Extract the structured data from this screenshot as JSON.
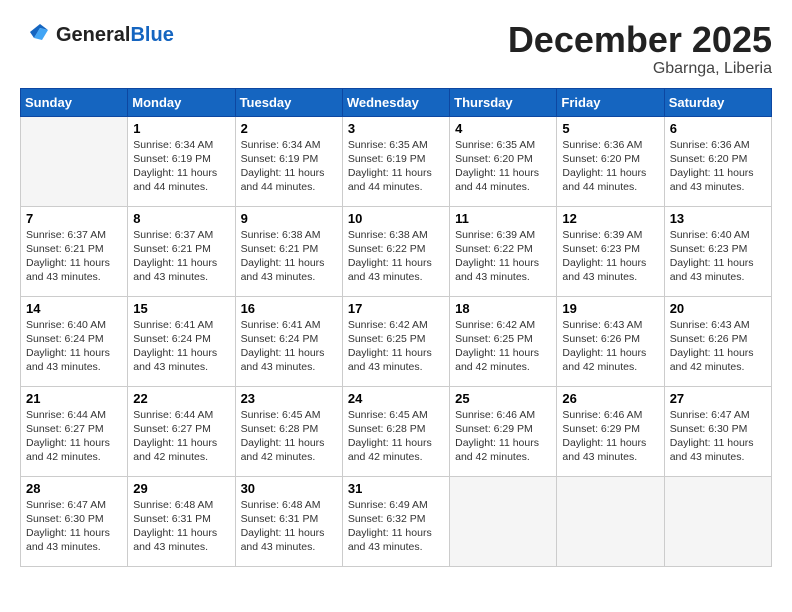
{
  "header": {
    "logo_line1": "General",
    "logo_line2": "Blue",
    "month": "December 2025",
    "location": "Gbarnga, Liberia"
  },
  "weekdays": [
    "Sunday",
    "Monday",
    "Tuesday",
    "Wednesday",
    "Thursday",
    "Friday",
    "Saturday"
  ],
  "weeks": [
    [
      {
        "day": "",
        "info": ""
      },
      {
        "day": "1",
        "info": "Sunrise: 6:34 AM\nSunset: 6:19 PM\nDaylight: 11 hours\nand 44 minutes."
      },
      {
        "day": "2",
        "info": "Sunrise: 6:34 AM\nSunset: 6:19 PM\nDaylight: 11 hours\nand 44 minutes."
      },
      {
        "day": "3",
        "info": "Sunrise: 6:35 AM\nSunset: 6:19 PM\nDaylight: 11 hours\nand 44 minutes."
      },
      {
        "day": "4",
        "info": "Sunrise: 6:35 AM\nSunset: 6:20 PM\nDaylight: 11 hours\nand 44 minutes."
      },
      {
        "day": "5",
        "info": "Sunrise: 6:36 AM\nSunset: 6:20 PM\nDaylight: 11 hours\nand 44 minutes."
      },
      {
        "day": "6",
        "info": "Sunrise: 6:36 AM\nSunset: 6:20 PM\nDaylight: 11 hours\nand 43 minutes."
      }
    ],
    [
      {
        "day": "7",
        "info": "Sunrise: 6:37 AM\nSunset: 6:21 PM\nDaylight: 11 hours\nand 43 minutes."
      },
      {
        "day": "8",
        "info": "Sunrise: 6:37 AM\nSunset: 6:21 PM\nDaylight: 11 hours\nand 43 minutes."
      },
      {
        "day": "9",
        "info": "Sunrise: 6:38 AM\nSunset: 6:21 PM\nDaylight: 11 hours\nand 43 minutes."
      },
      {
        "day": "10",
        "info": "Sunrise: 6:38 AM\nSunset: 6:22 PM\nDaylight: 11 hours\nand 43 minutes."
      },
      {
        "day": "11",
        "info": "Sunrise: 6:39 AM\nSunset: 6:22 PM\nDaylight: 11 hours\nand 43 minutes."
      },
      {
        "day": "12",
        "info": "Sunrise: 6:39 AM\nSunset: 6:23 PM\nDaylight: 11 hours\nand 43 minutes."
      },
      {
        "day": "13",
        "info": "Sunrise: 6:40 AM\nSunset: 6:23 PM\nDaylight: 11 hours\nand 43 minutes."
      }
    ],
    [
      {
        "day": "14",
        "info": "Sunrise: 6:40 AM\nSunset: 6:24 PM\nDaylight: 11 hours\nand 43 minutes."
      },
      {
        "day": "15",
        "info": "Sunrise: 6:41 AM\nSunset: 6:24 PM\nDaylight: 11 hours\nand 43 minutes."
      },
      {
        "day": "16",
        "info": "Sunrise: 6:41 AM\nSunset: 6:24 PM\nDaylight: 11 hours\nand 43 minutes."
      },
      {
        "day": "17",
        "info": "Sunrise: 6:42 AM\nSunset: 6:25 PM\nDaylight: 11 hours\nand 43 minutes."
      },
      {
        "day": "18",
        "info": "Sunrise: 6:42 AM\nSunset: 6:25 PM\nDaylight: 11 hours\nand 42 minutes."
      },
      {
        "day": "19",
        "info": "Sunrise: 6:43 AM\nSunset: 6:26 PM\nDaylight: 11 hours\nand 42 minutes."
      },
      {
        "day": "20",
        "info": "Sunrise: 6:43 AM\nSunset: 6:26 PM\nDaylight: 11 hours\nand 42 minutes."
      }
    ],
    [
      {
        "day": "21",
        "info": "Sunrise: 6:44 AM\nSunset: 6:27 PM\nDaylight: 11 hours\nand 42 minutes."
      },
      {
        "day": "22",
        "info": "Sunrise: 6:44 AM\nSunset: 6:27 PM\nDaylight: 11 hours\nand 42 minutes."
      },
      {
        "day": "23",
        "info": "Sunrise: 6:45 AM\nSunset: 6:28 PM\nDaylight: 11 hours\nand 42 minutes."
      },
      {
        "day": "24",
        "info": "Sunrise: 6:45 AM\nSunset: 6:28 PM\nDaylight: 11 hours\nand 42 minutes."
      },
      {
        "day": "25",
        "info": "Sunrise: 6:46 AM\nSunset: 6:29 PM\nDaylight: 11 hours\nand 42 minutes."
      },
      {
        "day": "26",
        "info": "Sunrise: 6:46 AM\nSunset: 6:29 PM\nDaylight: 11 hours\nand 43 minutes."
      },
      {
        "day": "27",
        "info": "Sunrise: 6:47 AM\nSunset: 6:30 PM\nDaylight: 11 hours\nand 43 minutes."
      }
    ],
    [
      {
        "day": "28",
        "info": "Sunrise: 6:47 AM\nSunset: 6:30 PM\nDaylight: 11 hours\nand 43 minutes."
      },
      {
        "day": "29",
        "info": "Sunrise: 6:48 AM\nSunset: 6:31 PM\nDaylight: 11 hours\nand 43 minutes."
      },
      {
        "day": "30",
        "info": "Sunrise: 6:48 AM\nSunset: 6:31 PM\nDaylight: 11 hours\nand 43 minutes."
      },
      {
        "day": "31",
        "info": "Sunrise: 6:49 AM\nSunset: 6:32 PM\nDaylight: 11 hours\nand 43 minutes."
      },
      {
        "day": "",
        "info": ""
      },
      {
        "day": "",
        "info": ""
      },
      {
        "day": "",
        "info": ""
      }
    ]
  ]
}
